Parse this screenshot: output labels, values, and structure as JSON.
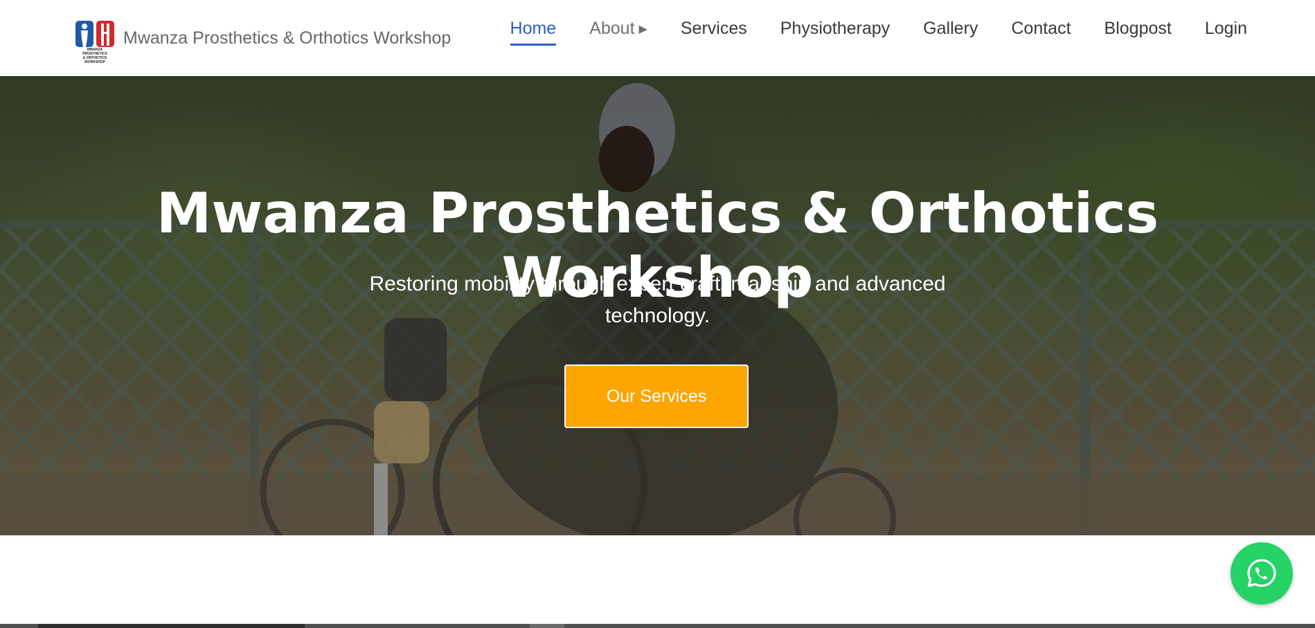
{
  "brand": {
    "name": "Mwanza Prosthetics & Orthotics Workshop",
    "logo_icon": "workshop-logo-icon",
    "logo_text_line1": "MWANZA PROSTHETICS",
    "logo_text_line2": "& ORTHOTICS WORKSHOP",
    "colors": {
      "blue": "#1f5aa8",
      "red": "#d0282e"
    }
  },
  "nav": {
    "items": [
      {
        "label": "Home",
        "state": "active"
      },
      {
        "label": "About",
        "has_submenu": true,
        "caret": "▶"
      },
      {
        "label": "Services"
      },
      {
        "label": "Physiotherapy"
      },
      {
        "label": "Gallery"
      },
      {
        "label": "Contact"
      },
      {
        "label": "Blogpost"
      },
      {
        "label": "Login"
      }
    ],
    "active_color": "#2f5fc7"
  },
  "hero": {
    "title": "Mwanza Prosthetics & Orthotics Workshop",
    "subtitle": "Restoring mobility through expert craftsmanship and advanced technology.",
    "cta_label": "Our Services",
    "cta_color": "#ffa500"
  },
  "floating": {
    "whatsapp_icon": "whatsapp-icon",
    "color": "#25d366"
  }
}
